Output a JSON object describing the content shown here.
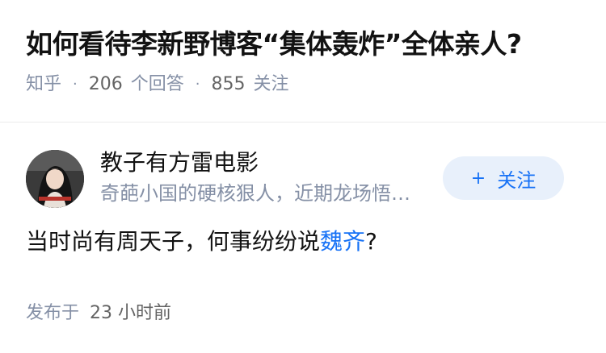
{
  "question": {
    "title": "如何看待李新野博客“集体轰炸”全体亲人?",
    "source": "知乎",
    "answer_count": "206",
    "answer_label": "个回答",
    "follower_count": "855",
    "follower_label": "关注"
  },
  "answer": {
    "author": {
      "name": "教子有方雷电影",
      "headline": "奇葩小国的硬核狠人，近期龙场悟…",
      "avatar_icon": "person-photo-avatar"
    },
    "follow_button": {
      "plus": "+",
      "label": "关注"
    },
    "content_before": "当时尚有周天子，何事纷纷说",
    "content_link": "魏齐",
    "content_after": "?",
    "publish_label": "发布于",
    "publish_time": "23 小时前"
  },
  "colors": {
    "accent": "#1772f6",
    "accent_bg": "#e8f0fb",
    "meta": "#8590a6"
  }
}
